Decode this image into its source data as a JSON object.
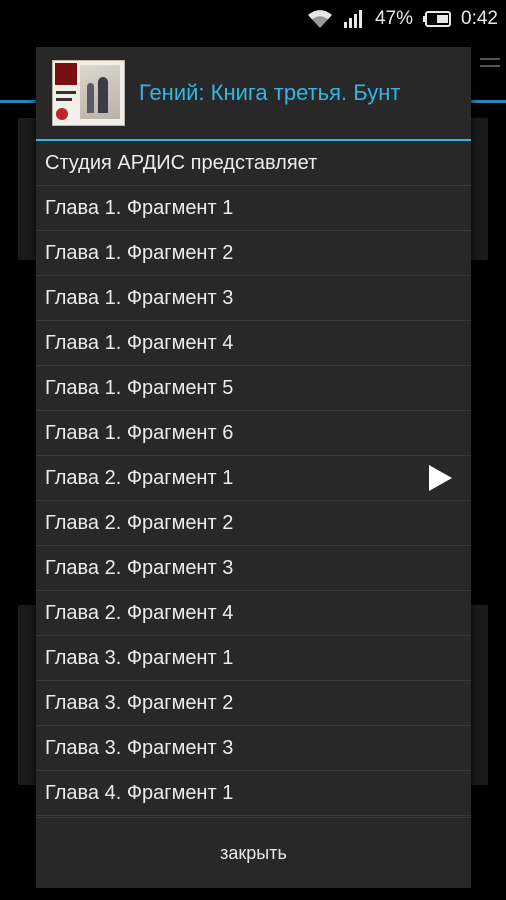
{
  "status_bar": {
    "battery_percent": "47%",
    "time": "0:42",
    "icons": [
      "wifi-icon",
      "signal-icon",
      "battery-icon"
    ]
  },
  "dialog": {
    "title": "Гений: Книга третья. Бунт",
    "cover_icon": "book-cover-thumbnail",
    "items": [
      {
        "label": "Студия АРДИС представляет",
        "playing": false
      },
      {
        "label": "Глава 1. Фрагмент 1",
        "playing": false
      },
      {
        "label": "Глава 1. Фрагмент 2",
        "playing": false
      },
      {
        "label": "Глава 1. Фрагмент 3",
        "playing": false
      },
      {
        "label": "Глава 1. Фрагмент 4",
        "playing": false
      },
      {
        "label": "Глава 1. Фрагмент 5",
        "playing": false
      },
      {
        "label": "Глава 1. Фрагмент 6",
        "playing": false
      },
      {
        "label": "Глава 2. Фрагмент 1",
        "playing": true
      },
      {
        "label": "Глава 2. Фрагмент 2",
        "playing": false
      },
      {
        "label": "Глава 2. Фрагмент 3",
        "playing": false
      },
      {
        "label": "Глава 2. Фрагмент 4",
        "playing": false
      },
      {
        "label": "Глава 3. Фрагмент 1",
        "playing": false
      },
      {
        "label": "Глава 3. Фрагмент 2",
        "playing": false
      },
      {
        "label": "Глава 3. Фрагмент 3",
        "playing": false
      },
      {
        "label": "Глава 4. Фрагмент 1",
        "playing": false
      }
    ],
    "close_label": "закрыть"
  },
  "colors": {
    "accent": "#33b5e5",
    "dialog_bg": "#282828",
    "divider": "#3a3a3a",
    "text": "#ececec"
  }
}
